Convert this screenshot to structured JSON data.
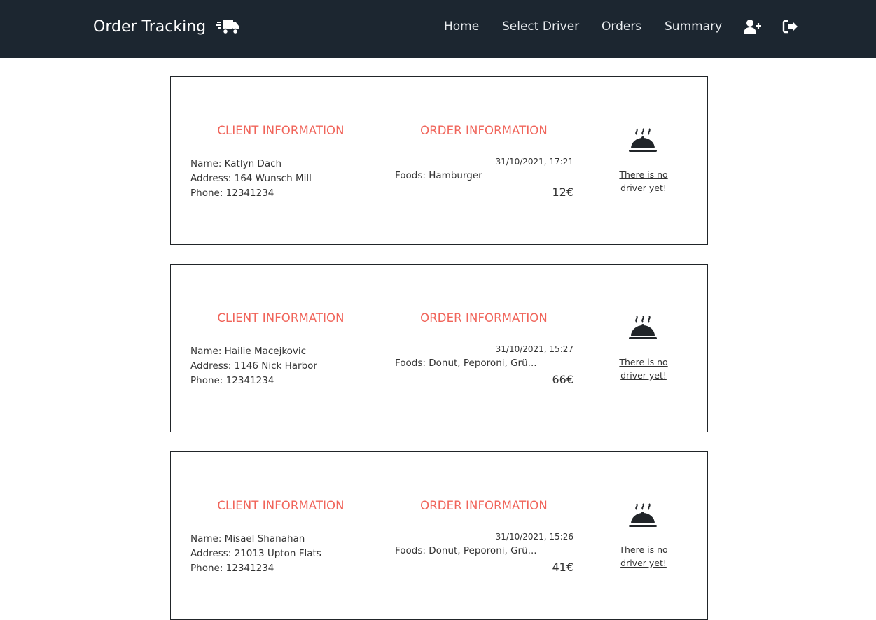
{
  "nav": {
    "brand": "Order Tracking",
    "brand_icon": "truck-icon",
    "links": {
      "home": "Home",
      "select_driver": "Select Driver",
      "orders": "Orders",
      "summary": "Summary"
    },
    "icons": [
      "add-user-icon",
      "logout-icon"
    ],
    "bg_color": "#1c2630"
  },
  "labels": {
    "client_title": "CLIENT INFORMATION",
    "order_title": "ORDER INFORMATION",
    "accent_color": "#f0645a"
  },
  "orders": [
    {
      "client": {
        "name": "Name: Katlyn Dach",
        "address": "Address: 164 Wunsch Mill",
        "phone": "Phone: 12341234"
      },
      "order": {
        "date": "31/10/2021, 17:21",
        "foods": "Foods: Hamburger",
        "price": "12€"
      },
      "driver": {
        "icon": "food-cloche-icon",
        "status": "There is no driver yet!"
      }
    },
    {
      "client": {
        "name": "Name: Hailie Macejkovic",
        "address": "Address: 1146 Nick Harbor",
        "phone": "Phone: 12341234"
      },
      "order": {
        "date": "31/10/2021, 15:27",
        "foods": "Foods: Donut, Peporoni, Grü...",
        "price": "66€"
      },
      "driver": {
        "icon": "food-cloche-icon",
        "status": "There is no driver yet!"
      }
    },
    {
      "client": {
        "name": "Name: Misael Shanahan",
        "address": "Address: 21013 Upton Flats",
        "phone": "Phone: 12341234"
      },
      "order": {
        "date": "31/10/2021, 15:26",
        "foods": "Foods: Donut, Peporoni, Grü...",
        "price": "41€"
      },
      "driver": {
        "icon": "food-cloche-icon",
        "status": "There is no driver yet!"
      }
    }
  ]
}
